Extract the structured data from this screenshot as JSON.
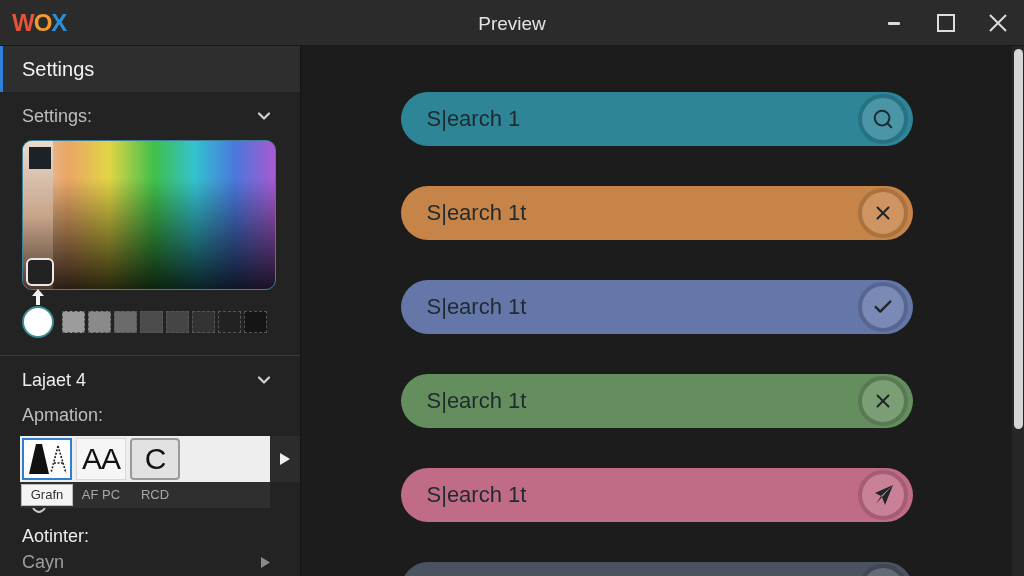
{
  "window": {
    "logo": "WOX",
    "title": "Preview"
  },
  "sidebar": {
    "header": {
      "label": "Settings",
      "selected": true
    },
    "sections": [
      {
        "kind": "colors",
        "title": "Settings:",
        "expanded": true,
        "swatches": [
          {
            "color": "#ffffff",
            "selected": true
          },
          {
            "color": "#9c9c9c",
            "selected": false
          },
          {
            "color": "#8a8a8a",
            "selected": false
          },
          {
            "color": "#6b6b6b",
            "selected": false
          },
          {
            "color": "#4b4b4b",
            "selected": false
          },
          {
            "color": "#454545",
            "selected": false
          },
          {
            "color": "#333333",
            "selected": false
          },
          {
            "color": "#222222",
            "selected": false
          },
          {
            "color": "#151515",
            "selected": false
          }
        ]
      },
      {
        "kind": "fonts",
        "title": "Lajaet 4",
        "expanded": true,
        "label": "Apmation:",
        "fonts": [
          {
            "kind": "glyph",
            "label": "Grafn",
            "selected": true
          },
          {
            "kind": "text",
            "sample": "AA",
            "label": "AF PC",
            "selected": false
          },
          {
            "kind": "boxed",
            "sample": "C",
            "label": "RCD",
            "selected": false
          }
        ]
      }
    ],
    "items": [
      {
        "kind": "heading",
        "label": "Aotinter:"
      },
      {
        "kind": "link",
        "label": "Cayn"
      }
    ]
  },
  "previews": [
    {
      "kind": "search",
      "text": "S|earch 1",
      "color": "#2d8597"
    },
    {
      "kind": "close",
      "text": "S|earch 1t",
      "color": "#c68448"
    },
    {
      "kind": "check",
      "text": "S|earch 1t",
      "color": "#6577a9"
    },
    {
      "kind": "close",
      "text": "S|earch 1t",
      "color": "#658e5f"
    },
    {
      "kind": "send",
      "text": "S|earch 1t",
      "color": "#c06c87"
    },
    {
      "kind": "blank",
      "color": "#4b5361"
    }
  ]
}
